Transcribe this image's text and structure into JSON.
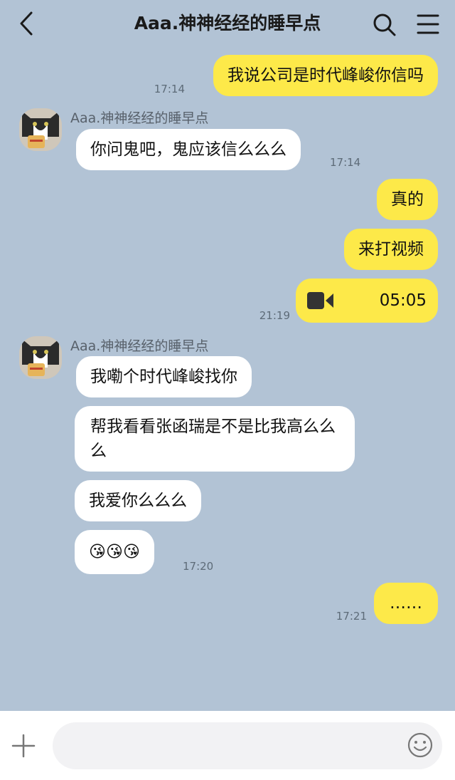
{
  "header": {
    "title": "Aaa.神神经经的睡早点",
    "back_icon": "chevron-left-icon",
    "search_icon": "search-icon",
    "menu_icon": "menu-icon"
  },
  "messages": [
    {
      "side": "me",
      "text": "我说公司是时代峰峻你信吗",
      "time": "17:14"
    },
    {
      "side": "them",
      "sender": "Aaa.神神经经的睡早点",
      "text": "你问鬼吧，鬼应该信么么么",
      "time": "17:14"
    },
    {
      "side": "me",
      "text": "真的"
    },
    {
      "side": "me",
      "text": "来打视频"
    },
    {
      "side": "me",
      "type": "video-call",
      "icon": "video-camera-icon",
      "duration": "05:05",
      "time": "21:19"
    },
    {
      "side": "them",
      "sender": "Aaa.神神经经的睡早点",
      "text": "我嘞个时代峰峻找你"
    },
    {
      "side": "them",
      "text": "帮我看看张函瑞是不是比我高么么么"
    },
    {
      "side": "them",
      "text": "我爱你么么么"
    },
    {
      "side": "them",
      "text": "😘😘😘",
      "time": "17:20"
    },
    {
      "side": "me",
      "text": "……",
      "time": "17:21"
    }
  ],
  "input": {
    "value": "",
    "placeholder": "",
    "plus_icon": "plus-icon",
    "emoji_icon": "emoji-smile-icon"
  },
  "colors": {
    "background": "#b2c3d5",
    "my_bubble": "#fde949",
    "their_bubble": "#ffffff"
  }
}
